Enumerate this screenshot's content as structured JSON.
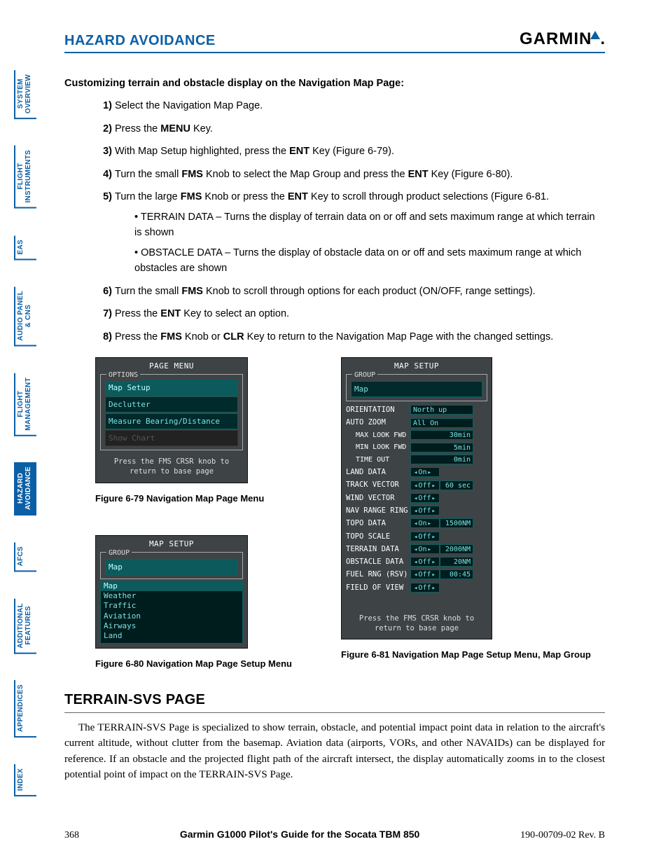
{
  "header": {
    "section": "HAZARD AVOIDANCE",
    "brand": "GARMIN"
  },
  "tabs": [
    {
      "label": "SYSTEM\nOVERVIEW",
      "active": false
    },
    {
      "label": "FLIGHT\nINSTRUMENTS",
      "active": false
    },
    {
      "label": "EAS",
      "active": false
    },
    {
      "label": "AUDIO PANEL\n& CNS",
      "active": false
    },
    {
      "label": "FLIGHT\nMANAGEMENT",
      "active": false
    },
    {
      "label": "HAZARD\nAVOIDANCE",
      "active": true
    },
    {
      "label": "AFCS",
      "active": false
    },
    {
      "label": "ADDITIONAL\nFEATURES",
      "active": false
    },
    {
      "label": "APPENDICES",
      "active": false
    },
    {
      "label": "INDEX",
      "active": false
    }
  ],
  "subhead": "Customizing terrain and obstacle display on the Navigation Map Page:",
  "steps": {
    "s1": "Select the Navigation Map Page.",
    "s2a": "Press the ",
    "s2b": "MENU",
    "s2c": " Key.",
    "s3a": "With Map Setup highlighted, press the ",
    "s3b": "ENT",
    "s3c": " Key (Figure 6-79).",
    "s4a": "Turn the small ",
    "s4b": "FMS",
    "s4c": " Knob to select the Map Group and press the ",
    "s4d": "ENT",
    "s4e": " Key (Figure 6-80).",
    "s5a": "Turn the large ",
    "s5b": "FMS",
    "s5c": " Knob or press the ",
    "s5d": "ENT",
    "s5e": " Key to scroll through product selections (Figure 6-81.",
    "b1": "TERRAIN DATA – Turns the display of terrain data on or off and sets maximum range at which terrain is shown",
    "b2": "OBSTACLE DATA – Turns the display of obstacle data on or off and sets maximum range at which obstacles are shown",
    "s6a": "Turn the small ",
    "s6b": "FMS",
    "s6c": " Knob to scroll through options for each product (ON/OFF, range settings).",
    "s7a": "Press the ",
    "s7b": "ENT",
    "s7c": " Key to select an option.",
    "s8a": "Press the ",
    "s8b": "FMS",
    "s8c": " Knob or ",
    "s8d": "CLR",
    "s8e": " Key to return to the Navigation Map Page with the changed settings."
  },
  "fig79": {
    "title": "PAGE MENU",
    "legend": "OPTIONS",
    "items": [
      "Map Setup",
      "Declutter",
      "Measure Bearing/Distance",
      "Show Chart"
    ],
    "hint1": "Press the FMS CRSR knob to",
    "hint2": "return to base page",
    "caption": "Figure 6-79  Navigation Map Page Menu"
  },
  "fig80": {
    "title": "MAP SETUP",
    "legend": "GROUP",
    "selected": "Map",
    "dropdown": [
      "Map",
      "Weather",
      "Traffic",
      "Aviation",
      "Airways",
      "Land"
    ],
    "caption": "Figure 6-80  Navigation Map Page Setup Menu"
  },
  "fig81": {
    "title": "MAP SETUP",
    "legend": "GROUP",
    "group": "Map",
    "rows": [
      {
        "lab": "ORIENTATION",
        "val": "North up",
        "full": true
      },
      {
        "lab": "AUTO ZOOM",
        "val": "All On",
        "full": true
      },
      {
        "lab": "MAX LOOK FWD",
        "val": "30min",
        "full": true,
        "r": true,
        "indent": true
      },
      {
        "lab": "MIN LOOK FWD",
        "val": "5min",
        "full": true,
        "r": true,
        "indent": true
      },
      {
        "lab": "TIME OUT",
        "val": "0min",
        "full": true,
        "r": true,
        "indent": true
      },
      {
        "lab": "LAND DATA",
        "val": "On",
        "arrow": true
      },
      {
        "lab": "TRACK VECTOR",
        "val": "Off",
        "arrow": true,
        "val2": "60 sec"
      },
      {
        "lab": "WIND VECTOR",
        "val": "Off",
        "arrow": true
      },
      {
        "lab": "NAV RANGE RING",
        "val": "Off",
        "arrow": true
      },
      {
        "lab": "TOPO DATA",
        "val": "On",
        "arrow": true,
        "val2": "1500NM"
      },
      {
        "lab": "TOPO SCALE",
        "val": "Off",
        "arrow": true
      },
      {
        "lab": "TERRAIN DATA",
        "val": "On",
        "arrow": true,
        "val2": "2000NM"
      },
      {
        "lab": "OBSTACLE DATA",
        "val": "Off",
        "arrow": true,
        "val2": "20NM"
      },
      {
        "lab": "FUEL RNG (RSV)",
        "val": "Off",
        "arrow": true,
        "val2": "00:45"
      },
      {
        "lab": "FIELD OF VIEW",
        "val": "Off",
        "arrow": true
      }
    ],
    "hint1": "Press the FMS CRSR knob to",
    "hint2": "return to base page",
    "caption": "Figure 6-81  Navigation Map Page Setup Menu, Map Group"
  },
  "section2": {
    "title": "TERRAIN-SVS PAGE",
    "body": "The TERRAIN-SVS Page is specialized to show terrain, obstacle, and potential impact point data in relation to the aircraft's current altitude, without clutter from the basemap.  Aviation data (airports, VORs, and other NAVAIDs) can be displayed for reference.  If an obstacle and the projected flight path of the aircraft intersect, the display automatically zooms in to the closest potential point of impact on the TERRAIN-SVS Page."
  },
  "footer": {
    "page": "368",
    "mid": "Garmin G1000 Pilot's Guide for the Socata TBM 850",
    "rev": "190-00709-02   Rev. B"
  }
}
